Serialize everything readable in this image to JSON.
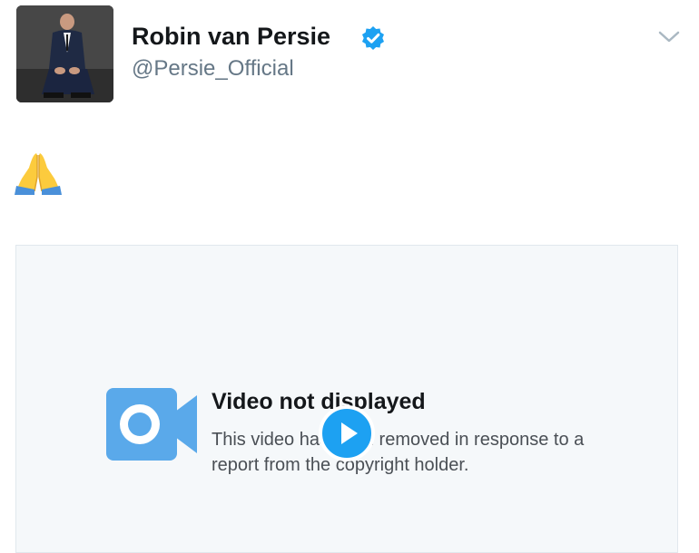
{
  "tweet": {
    "display_name": "Robin van Persie",
    "handle": "@Persie_Official",
    "verified": true,
    "body_emoji": "🙏"
  },
  "media_notice": {
    "title": "Video not displayed",
    "message": "This video has been removed in response to a report from the copyright holder."
  },
  "icons": {
    "verified": "verified-badge-icon",
    "menu": "chevron-down-icon",
    "camera": "video-camera-icon",
    "play": "play-icon",
    "emoji": "folded-hands-emoji"
  },
  "colors": {
    "accent": "#1da1f2",
    "camera_icon": "#5aa9ea",
    "card_background": "#f5f8fa",
    "secondary_text": "#657786"
  }
}
